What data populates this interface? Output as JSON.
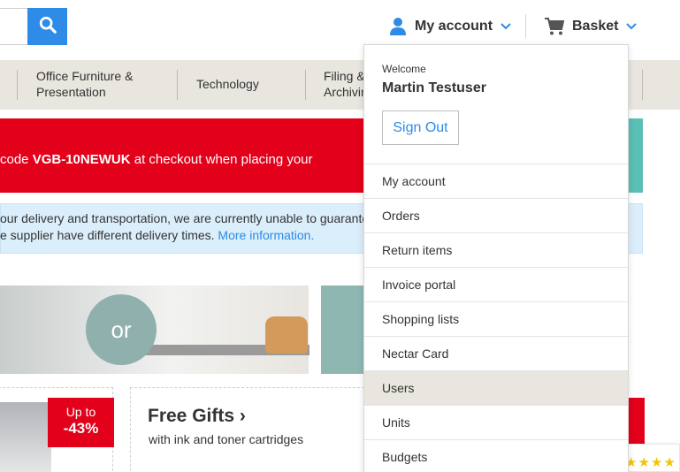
{
  "header": {
    "search_icon": "search-icon",
    "account_label": "My account",
    "basket_label": "Basket"
  },
  "categories": [
    {
      "line1": "Office Furniture &",
      "line2": "Presentation"
    },
    {
      "line1": "Technology",
      "line2": ""
    },
    {
      "line1": "Filing &",
      "line2": "Archivin"
    }
  ],
  "promo": {
    "prefix": "code ",
    "code": "VGB-10NEWUK",
    "suffix": " at checkout when placing your"
  },
  "info": {
    "line1": "our delivery and transportation, we are currently unable to guarantee",
    "line2": "e supplier have different delivery times. ",
    "link": "More information."
  },
  "hero": {
    "or_text": "or"
  },
  "cards": {
    "badge_top": "Up to",
    "badge_value": "-43%",
    "gifts_title": "Free Gifts ›",
    "gifts_subtitle": "with ink and toner cartridges"
  },
  "rating": {
    "stars": "★★★★"
  },
  "dropdown": {
    "welcome": "Welcome",
    "user_name": "Martin Testuser",
    "sign_out": "Sign Out",
    "items": [
      {
        "label": "My account"
      },
      {
        "label": "Orders"
      },
      {
        "label": "Return items"
      },
      {
        "label": "Invoice portal"
      },
      {
        "label": "Shopping lists"
      },
      {
        "label": "Nectar Card"
      },
      {
        "label": "Users"
      },
      {
        "label": "Units"
      },
      {
        "label": "Budgets"
      }
    ],
    "active_item": "Users"
  },
  "colors": {
    "brand_blue": "#2e8be8",
    "brand_red": "#e2001a",
    "nav_bg": "#e9e5df",
    "info_bg": "#dbeefb",
    "teal": "#5bbfb5"
  }
}
